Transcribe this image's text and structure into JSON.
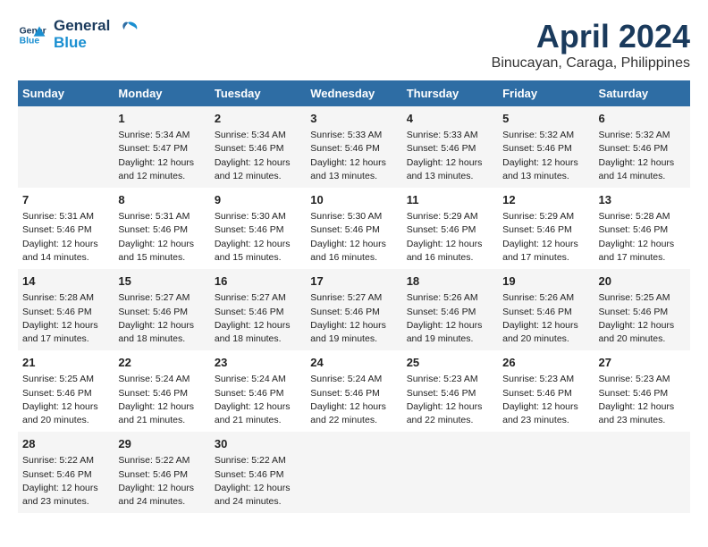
{
  "logo": {
    "line1": "General",
    "line2": "Blue"
  },
  "title": "April 2024",
  "subtitle": "Binucayan, Caraga, Philippines",
  "days_of_week": [
    "Sunday",
    "Monday",
    "Tuesday",
    "Wednesday",
    "Thursday",
    "Friday",
    "Saturday"
  ],
  "weeks": [
    [
      {
        "day": "",
        "info": ""
      },
      {
        "day": "1",
        "info": "Sunrise: 5:34 AM\nSunset: 5:47 PM\nDaylight: 12 hours\nand 12 minutes."
      },
      {
        "day": "2",
        "info": "Sunrise: 5:34 AM\nSunset: 5:46 PM\nDaylight: 12 hours\nand 12 minutes."
      },
      {
        "day": "3",
        "info": "Sunrise: 5:33 AM\nSunset: 5:46 PM\nDaylight: 12 hours\nand 13 minutes."
      },
      {
        "day": "4",
        "info": "Sunrise: 5:33 AM\nSunset: 5:46 PM\nDaylight: 12 hours\nand 13 minutes."
      },
      {
        "day": "5",
        "info": "Sunrise: 5:32 AM\nSunset: 5:46 PM\nDaylight: 12 hours\nand 13 minutes."
      },
      {
        "day": "6",
        "info": "Sunrise: 5:32 AM\nSunset: 5:46 PM\nDaylight: 12 hours\nand 14 minutes."
      }
    ],
    [
      {
        "day": "7",
        "info": "Sunrise: 5:31 AM\nSunset: 5:46 PM\nDaylight: 12 hours\nand 14 minutes."
      },
      {
        "day": "8",
        "info": "Sunrise: 5:31 AM\nSunset: 5:46 PM\nDaylight: 12 hours\nand 15 minutes."
      },
      {
        "day": "9",
        "info": "Sunrise: 5:30 AM\nSunset: 5:46 PM\nDaylight: 12 hours\nand 15 minutes."
      },
      {
        "day": "10",
        "info": "Sunrise: 5:30 AM\nSunset: 5:46 PM\nDaylight: 12 hours\nand 16 minutes."
      },
      {
        "day": "11",
        "info": "Sunrise: 5:29 AM\nSunset: 5:46 PM\nDaylight: 12 hours\nand 16 minutes."
      },
      {
        "day": "12",
        "info": "Sunrise: 5:29 AM\nSunset: 5:46 PM\nDaylight: 12 hours\nand 17 minutes."
      },
      {
        "day": "13",
        "info": "Sunrise: 5:28 AM\nSunset: 5:46 PM\nDaylight: 12 hours\nand 17 minutes."
      }
    ],
    [
      {
        "day": "14",
        "info": "Sunrise: 5:28 AM\nSunset: 5:46 PM\nDaylight: 12 hours\nand 17 minutes."
      },
      {
        "day": "15",
        "info": "Sunrise: 5:27 AM\nSunset: 5:46 PM\nDaylight: 12 hours\nand 18 minutes."
      },
      {
        "day": "16",
        "info": "Sunrise: 5:27 AM\nSunset: 5:46 PM\nDaylight: 12 hours\nand 18 minutes."
      },
      {
        "day": "17",
        "info": "Sunrise: 5:27 AM\nSunset: 5:46 PM\nDaylight: 12 hours\nand 19 minutes."
      },
      {
        "day": "18",
        "info": "Sunrise: 5:26 AM\nSunset: 5:46 PM\nDaylight: 12 hours\nand 19 minutes."
      },
      {
        "day": "19",
        "info": "Sunrise: 5:26 AM\nSunset: 5:46 PM\nDaylight: 12 hours\nand 20 minutes."
      },
      {
        "day": "20",
        "info": "Sunrise: 5:25 AM\nSunset: 5:46 PM\nDaylight: 12 hours\nand 20 minutes."
      }
    ],
    [
      {
        "day": "21",
        "info": "Sunrise: 5:25 AM\nSunset: 5:46 PM\nDaylight: 12 hours\nand 20 minutes."
      },
      {
        "day": "22",
        "info": "Sunrise: 5:24 AM\nSunset: 5:46 PM\nDaylight: 12 hours\nand 21 minutes."
      },
      {
        "day": "23",
        "info": "Sunrise: 5:24 AM\nSunset: 5:46 PM\nDaylight: 12 hours\nand 21 minutes."
      },
      {
        "day": "24",
        "info": "Sunrise: 5:24 AM\nSunset: 5:46 PM\nDaylight: 12 hours\nand 22 minutes."
      },
      {
        "day": "25",
        "info": "Sunrise: 5:23 AM\nSunset: 5:46 PM\nDaylight: 12 hours\nand 22 minutes."
      },
      {
        "day": "26",
        "info": "Sunrise: 5:23 AM\nSunset: 5:46 PM\nDaylight: 12 hours\nand 23 minutes."
      },
      {
        "day": "27",
        "info": "Sunrise: 5:23 AM\nSunset: 5:46 PM\nDaylight: 12 hours\nand 23 minutes."
      }
    ],
    [
      {
        "day": "28",
        "info": "Sunrise: 5:22 AM\nSunset: 5:46 PM\nDaylight: 12 hours\nand 23 minutes."
      },
      {
        "day": "29",
        "info": "Sunrise: 5:22 AM\nSunset: 5:46 PM\nDaylight: 12 hours\nand 24 minutes."
      },
      {
        "day": "30",
        "info": "Sunrise: 5:22 AM\nSunset: 5:46 PM\nDaylight: 12 hours\nand 24 minutes."
      },
      {
        "day": "",
        "info": ""
      },
      {
        "day": "",
        "info": ""
      },
      {
        "day": "",
        "info": ""
      },
      {
        "day": "",
        "info": ""
      }
    ]
  ]
}
